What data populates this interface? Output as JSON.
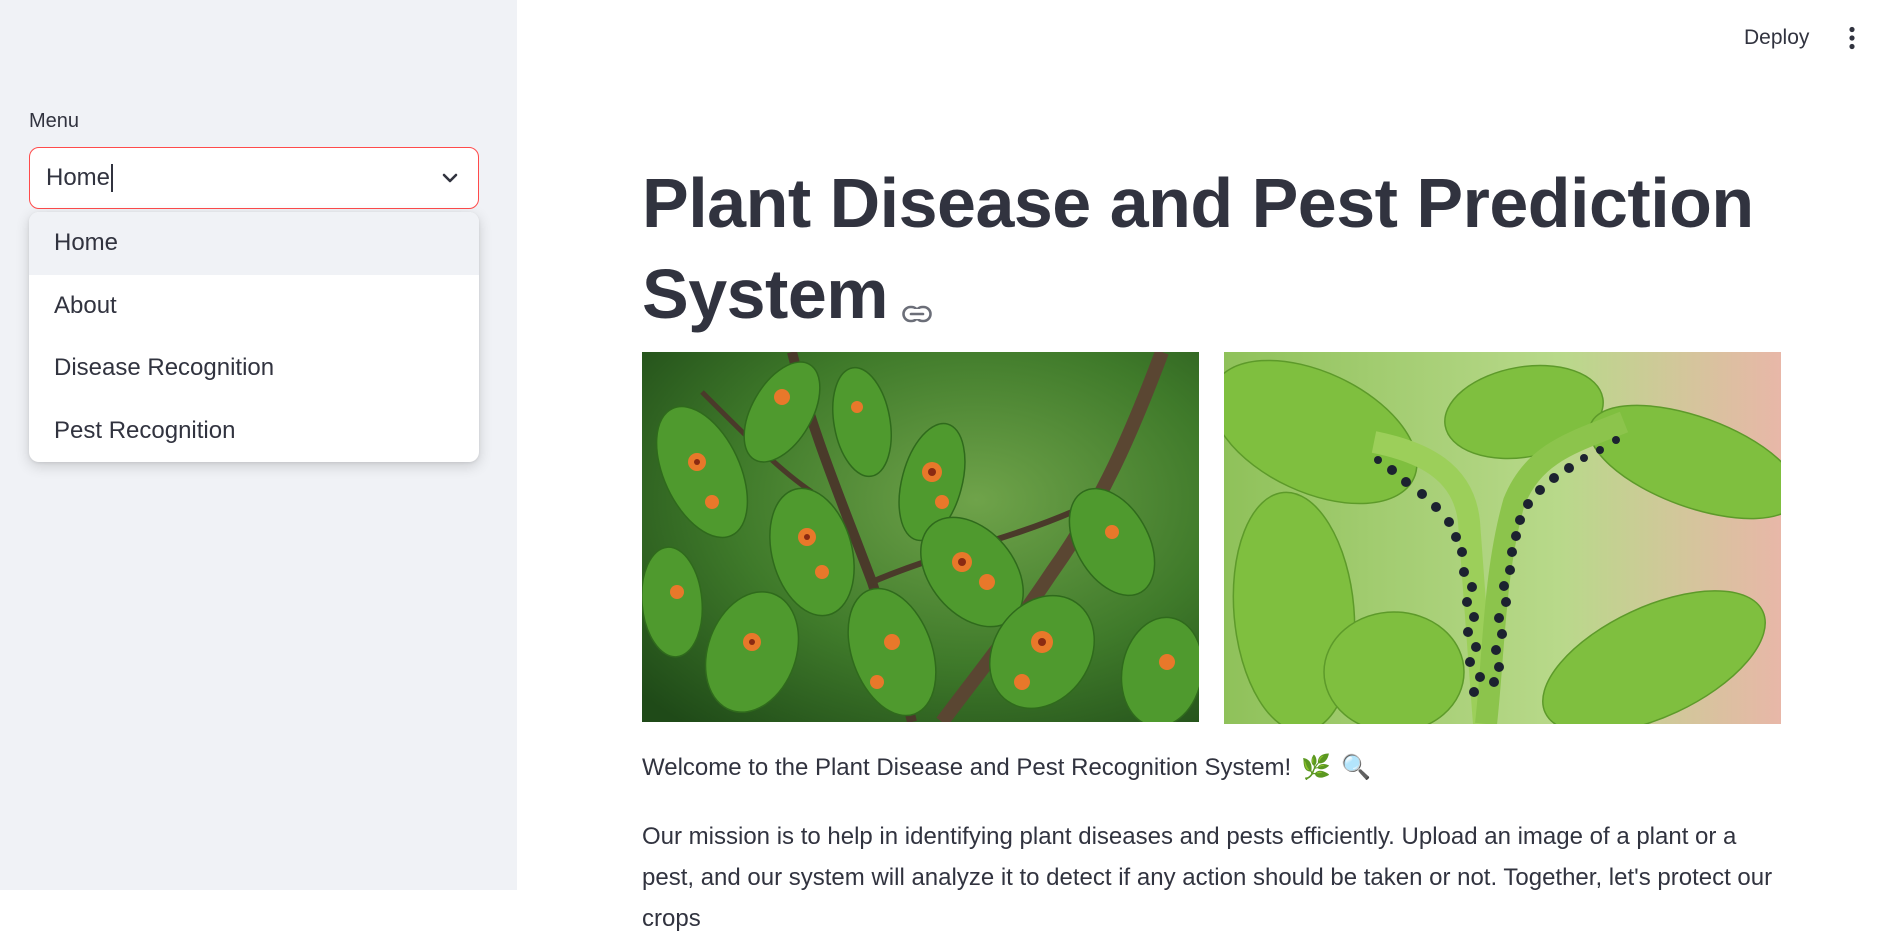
{
  "sidebar": {
    "menu_label": "Menu",
    "select_value": "Home",
    "options": [
      "Home",
      "About",
      "Disease Recognition",
      "Pest Recognition"
    ],
    "highlighted_option": "Home"
  },
  "header": {
    "deploy_label": "Deploy",
    "more_icon": "vertical-dots-icon"
  },
  "main": {
    "title_line1": "Plant Disease and Pest Prediction",
    "title_line2": "System",
    "title_link_icon": "link-icon",
    "images": [
      {
        "subject": "leaves with orange rust disease spots",
        "icon": "diseased-leaves-image"
      },
      {
        "subject": "plant stem covered with black aphids",
        "icon": "aphids-image"
      }
    ],
    "welcome_text": "Welcome to the Plant Disease and Pest Recognition System!",
    "welcome_emojis": [
      "🌿",
      "🔍"
    ],
    "mission_text": "Our mission is to help in identifying plant diseases and pests efficiently. Upload an image of a plant or a pest, and our system will analyze it to detect if any action should be taken or not. Together, let's protect our crops"
  },
  "colors": {
    "sidebar_bg": "#f0f2f6",
    "accent_border": "#ff4b4b",
    "text": "#31333f",
    "highlight_bg": "#f0f2f6"
  }
}
